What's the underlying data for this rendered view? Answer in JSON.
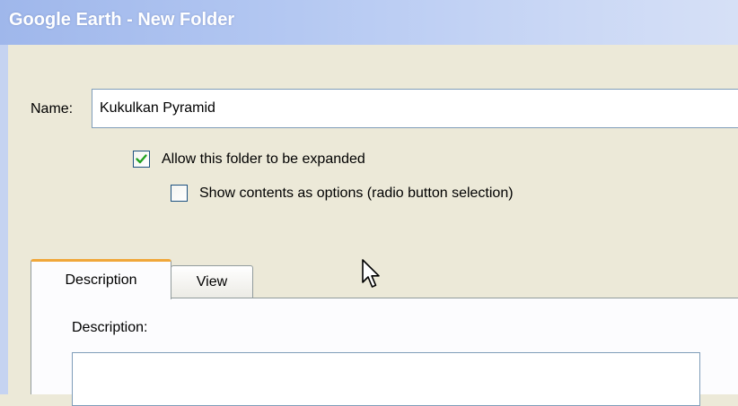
{
  "window": {
    "title": "Google Earth - New Folder"
  },
  "form": {
    "name_label": "Name:",
    "name_value": "Kukulkan Pyramid",
    "allow_expand": {
      "label": "Allow this folder to be expanded",
      "checked": true
    },
    "show_options": {
      "label": "Show contents as options (radio button selection)",
      "checked": false
    }
  },
  "tabs": [
    {
      "label": "Description",
      "active": true
    },
    {
      "label": "View",
      "active": false
    }
  ],
  "description": {
    "label": "Description:",
    "value": ""
  },
  "icons": {
    "checkmark": "checkmark-icon",
    "cursor": "mouse-pointer-icon"
  },
  "colors": {
    "dialog_bg": "#ece9d8",
    "titlebar": "#b4c8f2",
    "active_tab_accent": "#f0a73a",
    "check_green": "#21a121"
  }
}
